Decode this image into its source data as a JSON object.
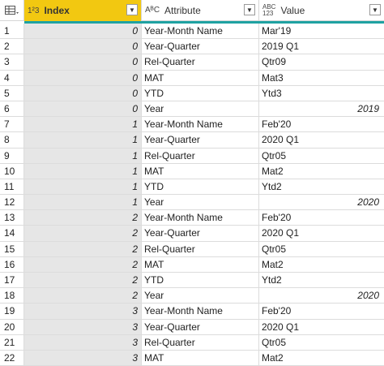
{
  "header": {
    "index_type": "1²3",
    "index_label": "Index",
    "attr_type": "AᴮC",
    "attr_label": "Attribute",
    "val_type_top": "ABC",
    "val_type_bottom": "123",
    "val_label": "Value"
  },
  "accent_color": "#f2c811",
  "rows": [
    {
      "n": "1",
      "index": "0",
      "attr": "Year-Month Name",
      "value": "Mar'19",
      "numeric": false
    },
    {
      "n": "2",
      "index": "0",
      "attr": "Year-Quarter",
      "value": "2019 Q1",
      "numeric": false
    },
    {
      "n": "3",
      "index": "0",
      "attr": "Rel-Quarter",
      "value": "Qtr09",
      "numeric": false
    },
    {
      "n": "4",
      "index": "0",
      "attr": "MAT",
      "value": "Mat3",
      "numeric": false
    },
    {
      "n": "5",
      "index": "0",
      "attr": "YTD",
      "value": "Ytd3",
      "numeric": false
    },
    {
      "n": "6",
      "index": "0",
      "attr": "Year",
      "value": "2019",
      "numeric": true
    },
    {
      "n": "7",
      "index": "1",
      "attr": "Year-Month Name",
      "value": "Feb'20",
      "numeric": false
    },
    {
      "n": "8",
      "index": "1",
      "attr": "Year-Quarter",
      "value": "2020 Q1",
      "numeric": false
    },
    {
      "n": "9",
      "index": "1",
      "attr": "Rel-Quarter",
      "value": "Qtr05",
      "numeric": false
    },
    {
      "n": "10",
      "index": "1",
      "attr": "MAT",
      "value": "Mat2",
      "numeric": false
    },
    {
      "n": "11",
      "index": "1",
      "attr": "YTD",
      "value": "Ytd2",
      "numeric": false
    },
    {
      "n": "12",
      "index": "1",
      "attr": "Year",
      "value": "2020",
      "numeric": true
    },
    {
      "n": "13",
      "index": "2",
      "attr": "Year-Month Name",
      "value": "Feb'20",
      "numeric": false
    },
    {
      "n": "14",
      "index": "2",
      "attr": "Year-Quarter",
      "value": "2020 Q1",
      "numeric": false
    },
    {
      "n": "15",
      "index": "2",
      "attr": "Rel-Quarter",
      "value": "Qtr05",
      "numeric": false
    },
    {
      "n": "16",
      "index": "2",
      "attr": "MAT",
      "value": "Mat2",
      "numeric": false
    },
    {
      "n": "17",
      "index": "2",
      "attr": "YTD",
      "value": "Ytd2",
      "numeric": false
    },
    {
      "n": "18",
      "index": "2",
      "attr": "Year",
      "value": "2020",
      "numeric": true
    },
    {
      "n": "19",
      "index": "3",
      "attr": "Year-Month Name",
      "value": "Feb'20",
      "numeric": false
    },
    {
      "n": "20",
      "index": "3",
      "attr": "Year-Quarter",
      "value": "2020 Q1",
      "numeric": false
    },
    {
      "n": "21",
      "index": "3",
      "attr": "Rel-Quarter",
      "value": "Qtr05",
      "numeric": false
    },
    {
      "n": "22",
      "index": "3",
      "attr": "MAT",
      "value": "Mat2",
      "numeric": false
    }
  ]
}
